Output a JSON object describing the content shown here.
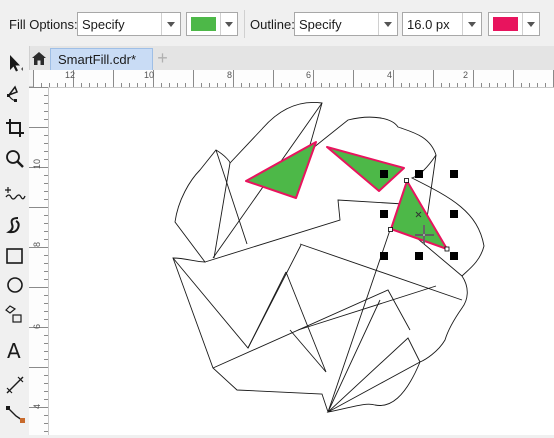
{
  "property_bar": {
    "fill_options_label": "Fill Options:",
    "fill_type": "Specify",
    "fill_color": "#4db848",
    "outline_label": "Outline:",
    "outline_type": "Specify",
    "outline_width": "16.0 px",
    "outline_color": "#e8145e"
  },
  "tabs": {
    "document_tab": "SmartFill.cdr*",
    "add_tab": "+"
  },
  "ruler": {
    "h_labels": [
      "12",
      "10",
      "8",
      "6",
      "4",
      "2"
    ],
    "v_labels": [
      "10",
      "8",
      "6",
      "4"
    ]
  },
  "toolbox": {
    "tools": [
      "pick-tool-icon",
      "shape-tool-icon",
      "crop-tool-icon",
      "zoom-tool-icon",
      "freehand-tool-icon",
      "artistic-media-tool-icon",
      "rectangle-tool-icon",
      "ellipse-tool-icon",
      "polygon-tool-icon",
      "text-tool-icon",
      "dimension-tool-icon",
      "connector-tool-icon"
    ]
  },
  "colors": {
    "accent_selection": "#000000",
    "tab_active": "#c9dcf5"
  }
}
